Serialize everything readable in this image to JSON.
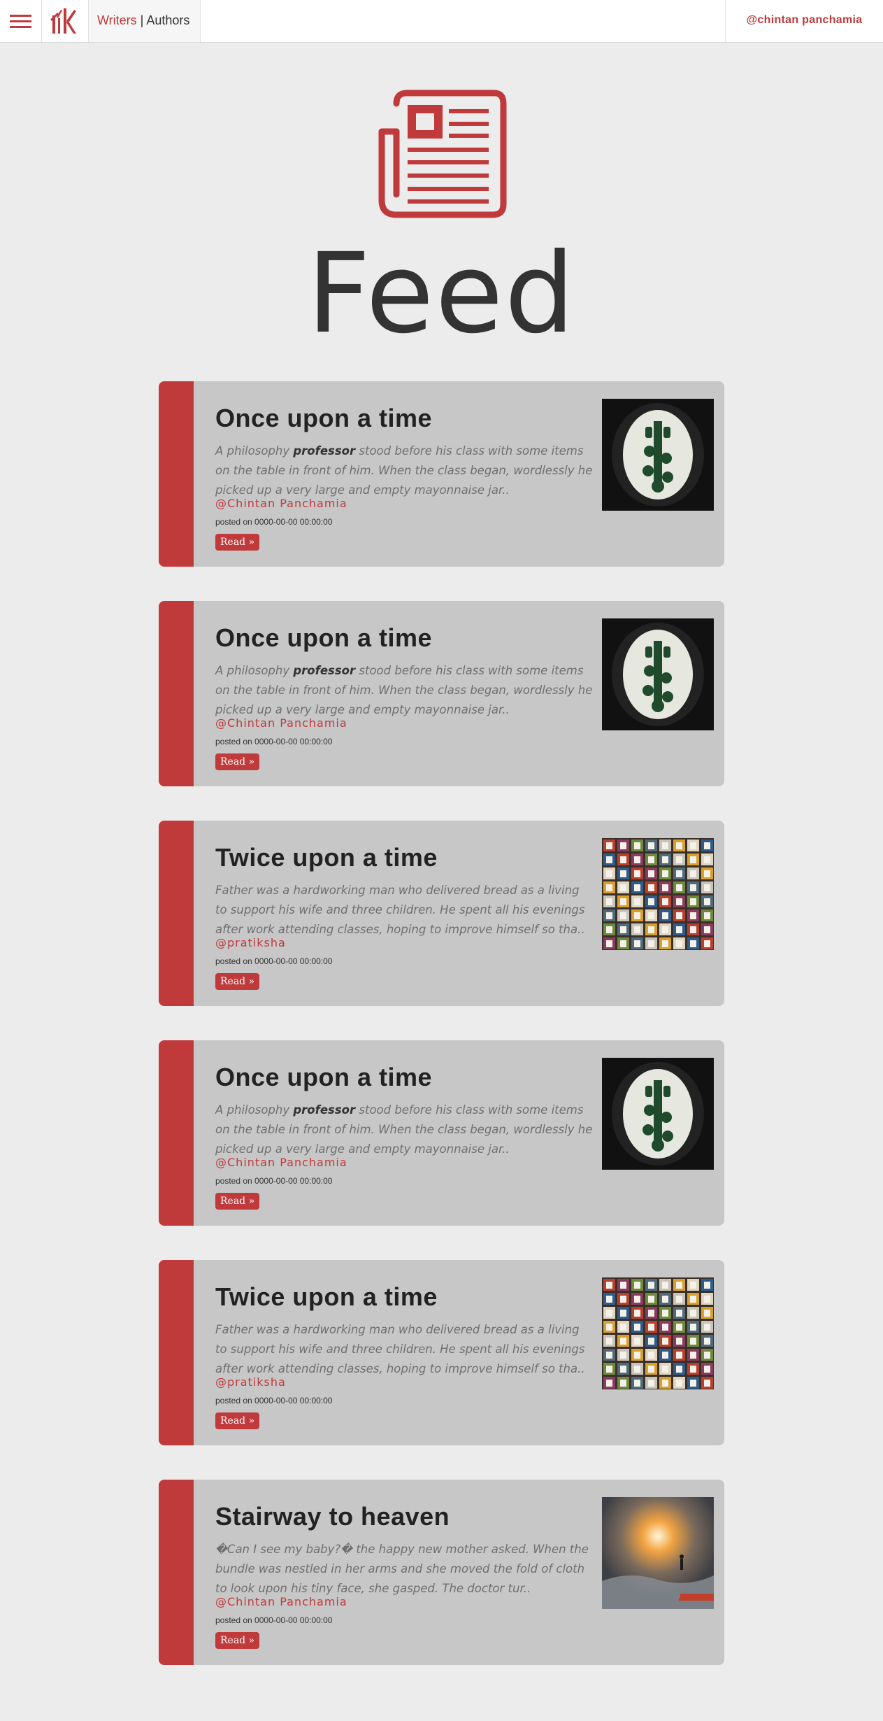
{
  "nav": {
    "brand_primary": "Writers",
    "brand_separator": " | ",
    "brand_secondary": "Authors",
    "user_handle": "@chintan panchamia"
  },
  "hero": {
    "icon": "newspaper-icon",
    "title": "Feed"
  },
  "colors": {
    "accent": "#c0393b",
    "card_bg": "#c7c7c7",
    "page_bg": "#ececec"
  },
  "feed": [
    {
      "title": "Once upon a time",
      "excerpt_before": "A philosophy ",
      "excerpt_bold": "professor",
      "excerpt_after": " stood before his class with some items on the table in front of him. When the class began, wordlessly he picked up a very large and empty mayonnaise jar..",
      "author": "@Chintan Panchamia",
      "posted": "posted on 0000-00-00 00:00:00",
      "read_label": "Read »",
      "image": "vinyl-record-tree"
    },
    {
      "title": "Once upon a time",
      "excerpt_before": "A philosophy ",
      "excerpt_bold": "professor",
      "excerpt_after": " stood before his class with some items on the table in front of him. When the class began, wordlessly he picked up a very large and empty mayonnaise jar..",
      "author": "@Chintan Panchamia",
      "posted": "posted on 0000-00-00 00:00:00",
      "read_label": "Read »",
      "image": "vinyl-record-tree"
    },
    {
      "title": "Twice upon a time",
      "excerpt_before": "Father was a hardworking man who delivered bread as a living to support his wife and three children. He spent all his evenings after work attending classes, hoping to improve himself so tha..",
      "excerpt_bold": "",
      "excerpt_after": "",
      "author": "@pratiksha",
      "posted": "posted on 0000-00-00 00:00:00",
      "read_label": "Read »",
      "image": "colorful-windows"
    },
    {
      "title": "Once upon a time",
      "excerpt_before": "A philosophy ",
      "excerpt_bold": "professor",
      "excerpt_after": " stood before his class with some items on the table in front of him. When the class began, wordlessly he picked up a very large and empty mayonnaise jar..",
      "author": "@Chintan Panchamia",
      "posted": "posted on 0000-00-00 00:00:00",
      "read_label": "Read »",
      "image": "vinyl-record-tree"
    },
    {
      "title": "Twice upon a time",
      "excerpt_before": "Father was a hardworking man who delivered bread as a living to support his wife and three children. He spent all his evenings after work attending classes, hoping to improve himself so tha..",
      "excerpt_bold": "",
      "excerpt_after": "",
      "author": "@pratiksha",
      "posted": "posted on 0000-00-00 00:00:00",
      "read_label": "Read »",
      "image": "colorful-windows"
    },
    {
      "title": "Stairway to heaven",
      "excerpt_before": "�Can I see my baby?� the happy new mother asked. When the bundle was nestled in her arms and she moved the fold of cloth to look upon his tiny face, she gasped. The doctor tur..",
      "excerpt_bold": "",
      "excerpt_after": "",
      "author": "@Chintan Panchamia",
      "posted": "posted on 0000-00-00 00:00:00",
      "read_label": "Read »",
      "image": "glowing-sky-figure"
    }
  ]
}
